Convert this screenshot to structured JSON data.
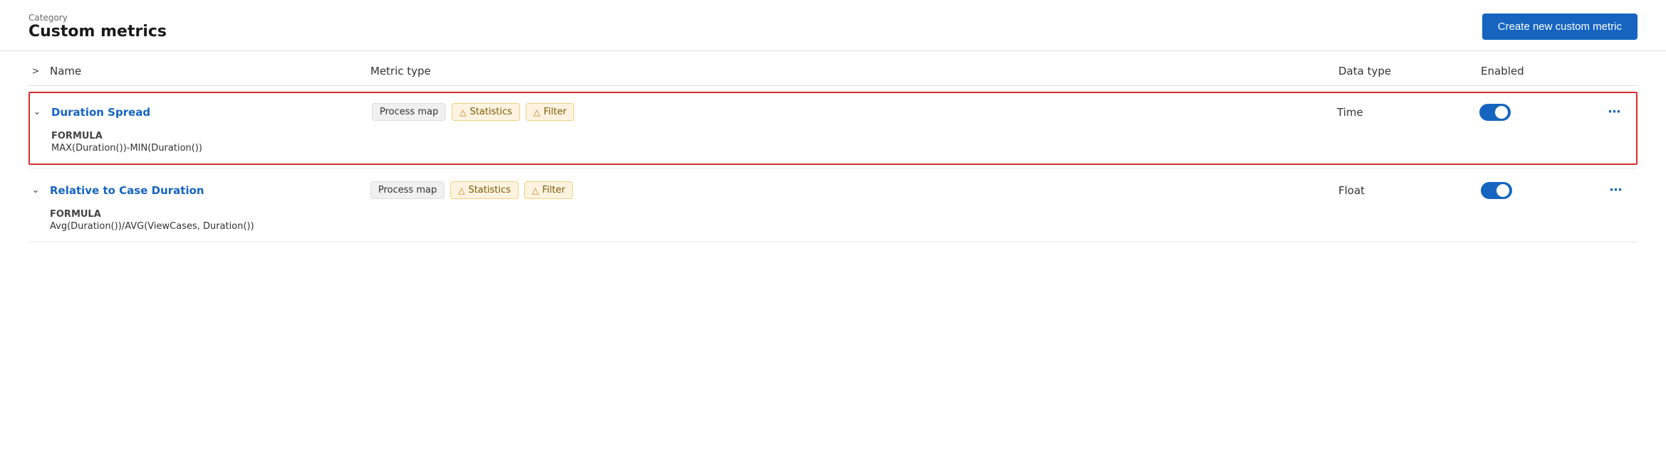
{
  "header": {
    "category_label": "Category",
    "page_title": "Custom metrics",
    "create_button_label": "Create new custom metric"
  },
  "table": {
    "columns": {
      "name": "Name",
      "metric_type": "Metric type",
      "data_type": "Data type",
      "enabled": "Enabled"
    },
    "rows": [
      {
        "id": "duration-spread",
        "name": "Duration Spread",
        "highlighted": true,
        "chips": [
          {
            "id": "process-map",
            "label": "Process map",
            "type": "neutral"
          },
          {
            "id": "statistics-1",
            "label": "Statistics",
            "type": "warning"
          },
          {
            "id": "filter-1",
            "label": "Filter",
            "type": "warning"
          }
        ],
        "data_type": "Time",
        "enabled": true,
        "formula_label": "FORMULA",
        "formula_value": "MAX(Duration())-MIN(Duration())"
      },
      {
        "id": "relative-to-case-duration",
        "name": "Relative to Case Duration",
        "highlighted": false,
        "chips": [
          {
            "id": "process-map-2",
            "label": "Process map",
            "type": "neutral"
          },
          {
            "id": "statistics-2",
            "label": "Statistics",
            "type": "warning"
          },
          {
            "id": "filter-2",
            "label": "Filter",
            "type": "warning"
          }
        ],
        "data_type": "Float",
        "enabled": true,
        "formula_label": "FORMULA",
        "formula_value": "Avg(Duration())/AVG(ViewCases, Duration())"
      }
    ]
  },
  "icons": {
    "expand_all": "›",
    "chevron_down": "∨",
    "warning": "⚠",
    "more": "···"
  }
}
